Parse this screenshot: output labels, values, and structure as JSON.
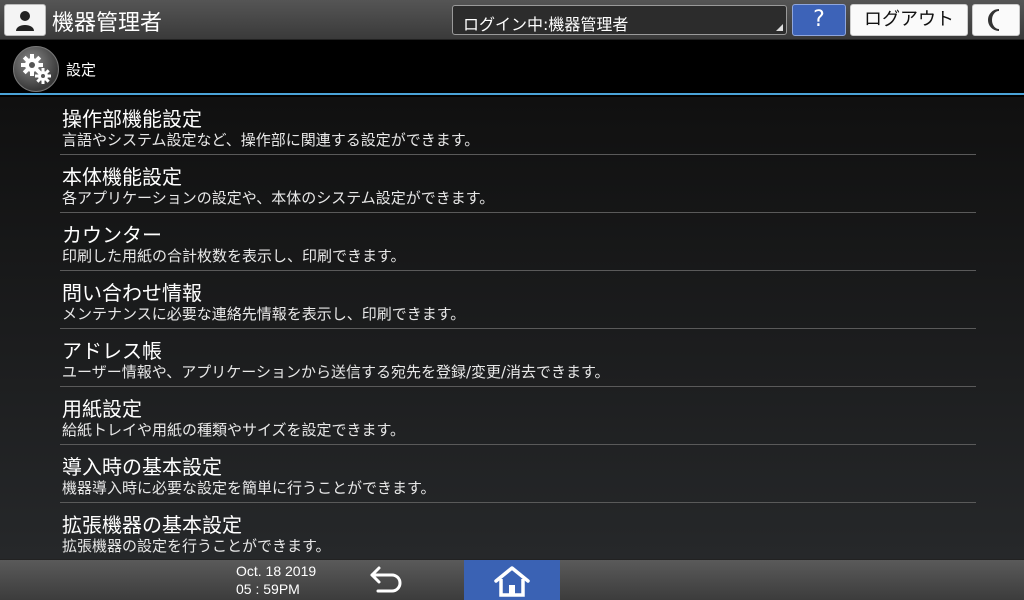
{
  "header": {
    "user_title": "機器管理者",
    "login_status": "ログイン中:機器管理者",
    "help_label": "?",
    "logout_label": "ログアウト",
    "icons": {
      "user": "user-icon",
      "night": "crescent-moon-icon"
    }
  },
  "subheader": {
    "title": "設定",
    "icon": "gear-icon"
  },
  "menu": [
    {
      "title": "操作部機能設定",
      "desc": "言語やシステム設定など、操作部に関連する設定ができます。"
    },
    {
      "title": "本体機能設定",
      "desc": "各アプリケーションの設定や、本体のシステム設定ができます。"
    },
    {
      "title": "カウンター",
      "desc": "印刷した用紙の合計枚数を表示し、印刷できます。"
    },
    {
      "title": "問い合わせ情報",
      "desc": "メンテナンスに必要な連絡先情報を表示し、印刷できます。"
    },
    {
      "title": "アドレス帳",
      "desc": "ユーザー情報や、アプリケーションから送信する宛先を登録/変更/消去できます。"
    },
    {
      "title": "用紙設定",
      "desc": "給紙トレイや用紙の種類やサイズを設定できます。"
    },
    {
      "title": "導入時の基本設定",
      "desc": "機器導入時に必要な設定を簡単に行うことができます。"
    },
    {
      "title": "拡張機器の基本設定",
      "desc": "拡張機器の設定を行うことができます。"
    }
  ],
  "footer": {
    "date": "Oct. 18 2019",
    "time": "05 : 59PM",
    "icons": {
      "back": "back-arrow-icon",
      "home": "home-icon"
    }
  },
  "colors": {
    "accent_line": "#4aa3d8",
    "help_button": "#3d63b8",
    "home_button": "#3a62b4"
  }
}
